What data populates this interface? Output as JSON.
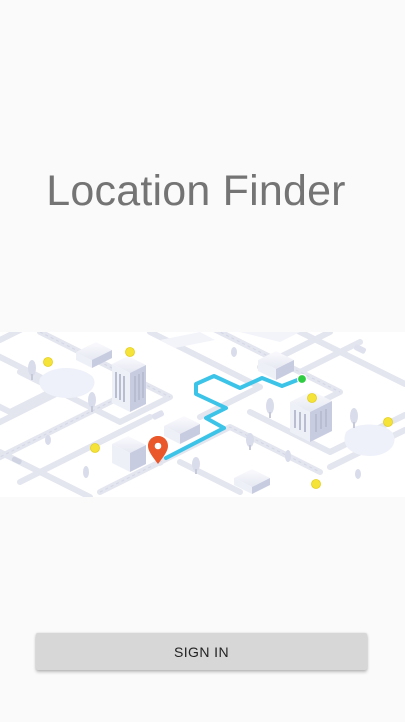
{
  "app": {
    "title": "Location Finder"
  },
  "hero": {
    "illustration": "isometric-city-map-with-route",
    "route_color": "#3cc3e8",
    "origin_color": "#2ecc40",
    "destination_pin_color": "#e9572b",
    "marker_color": "#f5e33a"
  },
  "actions": {
    "sign_in_label": "SIGN IN"
  }
}
